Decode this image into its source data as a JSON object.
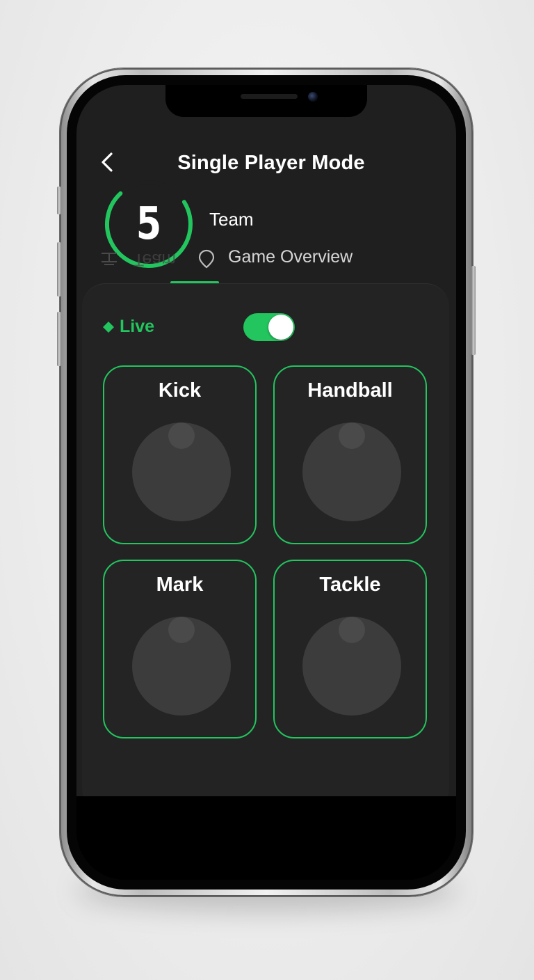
{
  "header": {
    "title": "Single Player Mode",
    "back_icon": "chevron-left-icon"
  },
  "score": {
    "value": "5",
    "ring_progress": 0.72,
    "ring_color": "#22c55e"
  },
  "team": {
    "label": "Team"
  },
  "tabs": [
    {
      "label": "Team",
      "icon": "lineup-icon",
      "active": true
    },
    {
      "label": "Game Overview",
      "icon": "map-pin-icon",
      "active": false
    }
  ],
  "live": {
    "label": "Live",
    "icon": "diamond-icon",
    "toggle_on": true
  },
  "actions": [
    {
      "label": "Kick"
    },
    {
      "label": "Handball"
    },
    {
      "label": "Mark"
    },
    {
      "label": "Tackle"
    }
  ],
  "colors": {
    "accent": "#22c55e",
    "background": "#1f1f1f",
    "card": "#242424",
    "dial": "#3c3c3c"
  }
}
